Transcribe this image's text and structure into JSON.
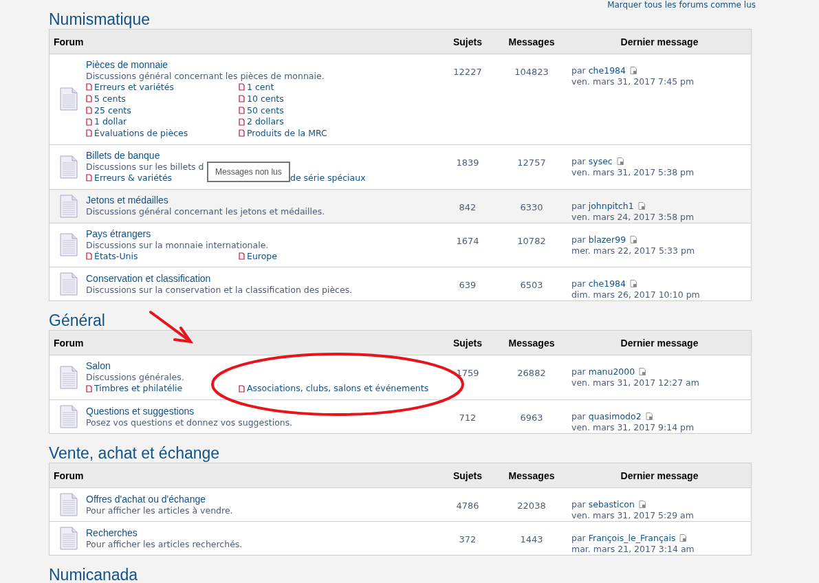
{
  "mark_all_read": "Marquer tous les forums comme lus",
  "sections": [
    {
      "title": "Numismatique",
      "columns": [
        "Forum",
        "Sujets",
        "Messages",
        "Dernier message"
      ],
      "rows": [
        {
          "title": "Pièces de monnaie",
          "description": "Discussions général concernant les pièces de monnaie.",
          "highlighted": false,
          "topics": "12227",
          "posts": "104823",
          "by": "par",
          "author": "che1984",
          "date": "ven. mars 31, 2017 7:45 pm",
          "subforums": [
            {
              "label": "Erreurs et variétés",
              "kind": "link"
            },
            {
              "label": "1 cent",
              "kind": "link"
            },
            {
              "label": "5 cents",
              "kind": "link"
            },
            {
              "label": "10 cents",
              "kind": "link"
            },
            {
              "label": "25 cents",
              "kind": "link"
            },
            {
              "label": "50 cents",
              "kind": "link"
            },
            {
              "label": "1 dollar",
              "kind": "link"
            },
            {
              "label": "2 dollars",
              "kind": "link"
            },
            {
              "label": "Évaluations de pièces",
              "kind": "link"
            },
            {
              "label": "Produits de la MRC",
              "kind": "link"
            }
          ]
        },
        {
          "title": "Billets de banque",
          "description": "Discussions sur les billets d",
          "highlighted": false,
          "topics": "1839",
          "posts": "12757",
          "by": "par",
          "author": "sysec",
          "date": "ven. mars 31, 2017 5:38 pm",
          "tooltip": "Messages non lus",
          "subforums": [
            {
              "label": "Erreurs & variétés",
              "kind": "link"
            },
            {
              "label": "de série spéciaux",
              "kind": "covered"
            }
          ]
        },
        {
          "title": "Jetons et médailles",
          "description": "Discussions général concernant les jetons et médailles.",
          "highlighted": true,
          "topics": "842",
          "posts": "6330",
          "by": "par",
          "author": "johnpitch1",
          "date": "ven. mars 24, 2017 3:58 pm"
        },
        {
          "title": "Pays étrangers",
          "description": "Discussions sur la monnaie internationale.",
          "highlighted": false,
          "topics": "1674",
          "posts": "10782",
          "by": "par",
          "author": "blazer99",
          "date": "mer. mars 22, 2017 5:33 pm",
          "subforums": [
            {
              "label": "États-Unis",
              "kind": "link"
            },
            {
              "label": "Europe",
              "kind": "link"
            }
          ]
        },
        {
          "title": "Conservation et classification",
          "description": "Discussions sur la conservation et la classification des pièces.",
          "highlighted": false,
          "topics": "639",
          "posts": "6503",
          "by": "par",
          "author": "che1984",
          "date": "dim. mars 26, 2017 10:10 pm"
        }
      ]
    },
    {
      "title": "Général",
      "columns": [
        "Forum",
        "Sujets",
        "Messages",
        "Dernier message"
      ],
      "rows": [
        {
          "title": "Salon",
          "description": "Discussions générales.",
          "highlighted": false,
          "topics": "1759",
          "posts": "26882",
          "by": "par",
          "author": "manu2000",
          "date": "ven. mars 31, 2017 12:27 am",
          "subforums": [
            {
              "label": "Timbres et philatélie",
              "kind": "link"
            },
            {
              "label": "Associations, clubs, salons et événements",
              "kind": "link"
            }
          ]
        },
        {
          "title": "Questions et suggestions",
          "description": "Posez vos questions et donnez vos suggestions.",
          "highlighted": false,
          "topics": "712",
          "posts": "6963",
          "by": "par",
          "author": "quasimodo2",
          "date": "ven. mars 31, 2017 9:14 pm"
        }
      ]
    },
    {
      "title": "Vente, achat et échange",
      "columns": [
        "Forum",
        "Sujets",
        "Messages",
        "Dernier message"
      ],
      "rows": [
        {
          "title": "Offres d'achat ou d'échange",
          "description": "Pour afficher les articles à vendre.",
          "highlighted": false,
          "topics": "4786",
          "posts": "22038",
          "by": "par",
          "author": "sebasticon",
          "date": "ven. mars 31, 2017 5:29 am"
        },
        {
          "title": "Recherches",
          "description": "Pour afficher les articles recherchés.",
          "highlighted": false,
          "topics": "372",
          "posts": "1443",
          "by": "par",
          "author": "François_le_Français",
          "date": "mar. mars 21, 2017 3:14 am"
        }
      ]
    },
    {
      "title": "Numicanada"
    }
  ],
  "arrow_annotation": {
    "color": "#e8141c"
  },
  "ellipse_annotation": {
    "color": "#e8141c"
  }
}
